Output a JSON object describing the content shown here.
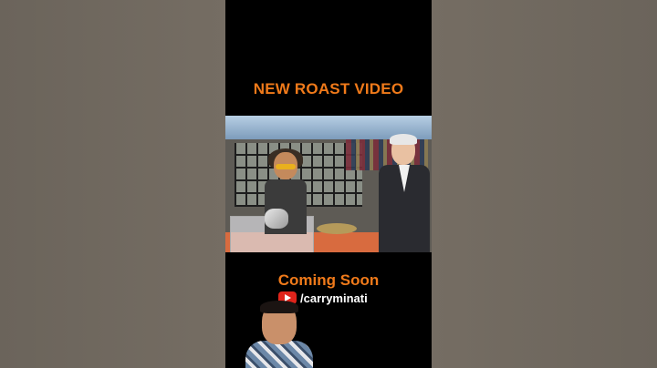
{
  "headline": "NEW ROAST VIDEO",
  "coming_soon": "Coming Soon",
  "channel_handle": "/carryminati",
  "icons": {
    "channel": "youtube-icon"
  },
  "colors": {
    "accent": "#f07a1a",
    "frame_bg": "#000000",
    "side_bg": "#71695f"
  }
}
